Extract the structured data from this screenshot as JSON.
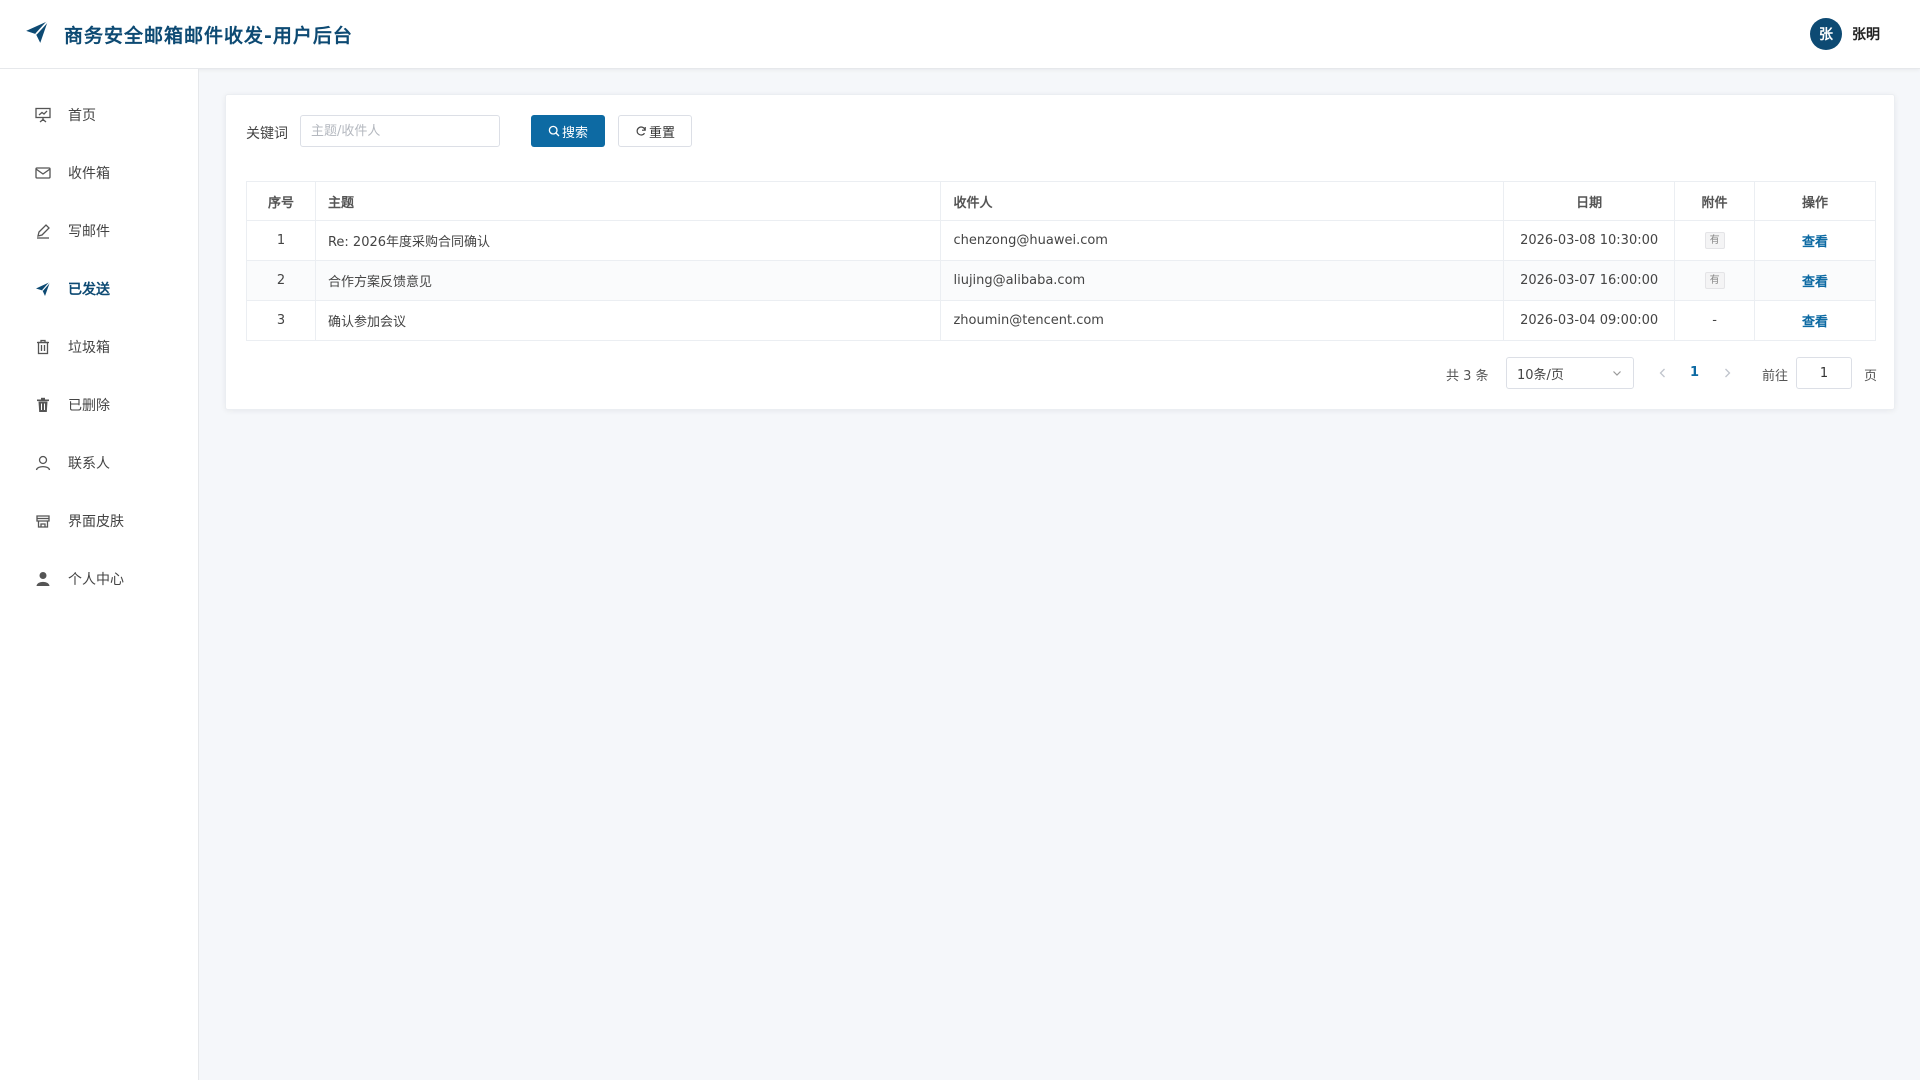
{
  "app": {
    "title": "商务安全邮箱邮件收发-用户后台",
    "brand_color": "#0d4a73",
    "accent_color": "#0d6aa3"
  },
  "user": {
    "avatar_char": "张",
    "name": "张明"
  },
  "sidebar": {
    "items": [
      {
        "label": "首页",
        "icon": "presentation-icon",
        "active": false
      },
      {
        "label": "收件箱",
        "icon": "envelope-icon",
        "active": false
      },
      {
        "label": "写邮件",
        "icon": "pen-icon",
        "active": false
      },
      {
        "label": "已发送",
        "icon": "paper-plane-icon",
        "active": true
      },
      {
        "label": "垃圾箱",
        "icon": "trash-outline-icon",
        "active": false
      },
      {
        "label": "已删除",
        "icon": "trash-filled-icon",
        "active": false
      },
      {
        "label": "联系人",
        "icon": "user-outline-icon",
        "active": false
      },
      {
        "label": "界面皮肤",
        "icon": "skin-icon",
        "active": false
      },
      {
        "label": "个人中心",
        "icon": "user-filled-icon",
        "active": false
      }
    ]
  },
  "search": {
    "label": "关键词",
    "placeholder": "主题/收件人",
    "value": "",
    "search_button": "搜索",
    "reset_button": "重置"
  },
  "table": {
    "columns": [
      "序号",
      "主题",
      "收件人",
      "日期",
      "附件",
      "操作"
    ],
    "rows": [
      {
        "idx": "1",
        "subject": "Re: 2026年度采购合同确认",
        "recipient": "chenzong@huawei.com",
        "date": "2026-03-08 10:30:00",
        "attachment": "有",
        "action": "查看"
      },
      {
        "idx": "2",
        "subject": "合作方案反馈意见",
        "recipient": "liujing@alibaba.com",
        "date": "2026-03-07 16:00:00",
        "attachment": "有",
        "action": "查看"
      },
      {
        "idx": "3",
        "subject": "确认参加会议",
        "recipient": "zhoumin@tencent.com",
        "date": "2026-03-04 09:00:00",
        "attachment": "-",
        "action": "查看"
      }
    ]
  },
  "pagination": {
    "total": "共 3 条",
    "page_size": "10条/页",
    "current_page": "1",
    "goto_label": "前往",
    "goto_value": "1",
    "goto_suffix": "页"
  }
}
